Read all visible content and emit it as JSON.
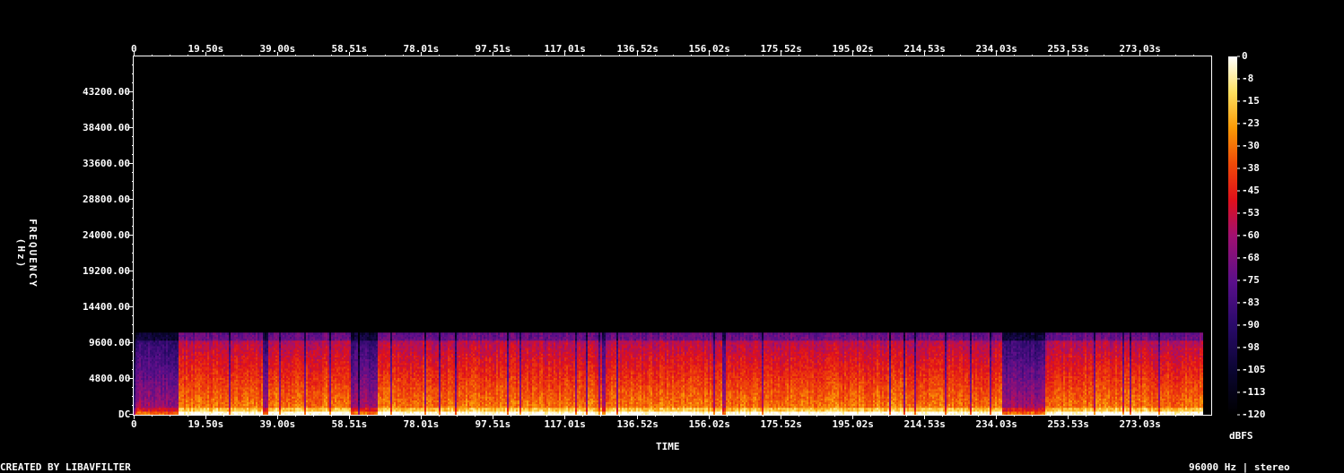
{
  "chart_data": {
    "type": "heatmap",
    "title": "",
    "xlabel": "TIME",
    "ylabel": "FREQUENCY (Hz)",
    "x_unit": "s",
    "x_ticks": [
      "0",
      "19.50s",
      "39.00s",
      "58.51s",
      "78.01s",
      "97.51s",
      "117.01s",
      "136.52s",
      "156.02s",
      "175.52s",
      "195.02s",
      "214.53s",
      "234.03s",
      "253.53s",
      "273.03s"
    ],
    "x_tick_values": [
      0,
      19.5,
      39.0,
      58.51,
      78.01,
      97.51,
      117.01,
      136.52,
      156.02,
      175.52,
      195.02,
      214.53,
      234.03,
      253.53,
      273.03
    ],
    "xlim": [
      0,
      292.5
    ],
    "y_ticks": [
      "DC",
      "4800.00",
      "9600.00",
      "14400.00",
      "19200.00",
      "24000.00",
      "28800.00",
      "33600.00",
      "38400.00",
      "43200.00"
    ],
    "y_tick_values": [
      0,
      4800,
      9600,
      14400,
      19200,
      24000,
      28800,
      33600,
      38400,
      43200
    ],
    "ylim": [
      0,
      48000
    ],
    "colorbar": {
      "label": "dBFS",
      "ticks": [
        "0",
        "-8",
        "-15",
        "-23",
        "-30",
        "-38",
        "-45",
        "-53",
        "-60",
        "-68",
        "-75",
        "-83",
        "-90",
        "-98",
        "-105",
        "-113",
        "-120"
      ],
      "range": [
        -120,
        0
      ]
    },
    "content": {
      "audio_end_s": 290,
      "bandwidth_limit_hz": 11000,
      "quiet_intervals_s": [
        [
          0,
          12
        ],
        [
          59,
          66
        ],
        [
          236,
          247
        ]
      ]
    }
  },
  "footer": {
    "credit": "CREATED BY LIBAVFILTER",
    "info": "96000 Hz | stereo"
  }
}
